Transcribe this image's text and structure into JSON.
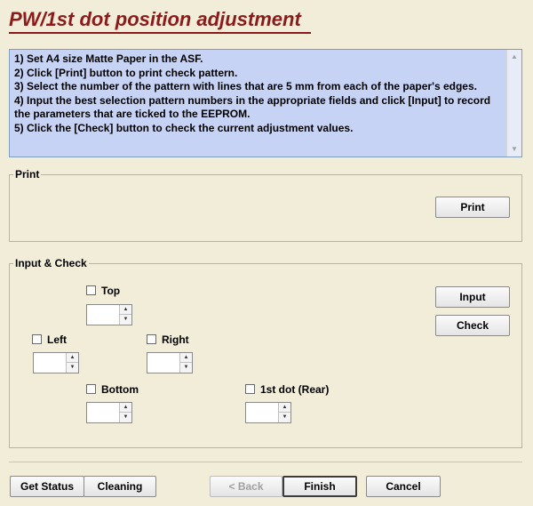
{
  "title": "PW/1st dot position adjustment",
  "instructions": {
    "text": "1) Set A4 size Matte Paper in the ASF.\n2) Click [Print] button to print check pattern.\n3) Select the number of the pattern with lines that are 5 mm from each of the paper's edges.\n4) Input the best selection pattern numbers in the appropriate fields and click [Input] to record the parameters that are ticked to the EEPROM.\n5) Click the [Check] button to check the current adjustment values."
  },
  "print_group": {
    "label": "Print",
    "print_button": "Print"
  },
  "input_group": {
    "label": "Input & Check",
    "input_button": "Input",
    "check_button": "Check",
    "top_label": "Top",
    "left_label": "Left",
    "right_label": "Right",
    "bottom_label": "Bottom",
    "first_dot_label": "1st dot (Rear)",
    "top_value": "",
    "left_value": "",
    "right_value": "",
    "bottom_value": "",
    "first_dot_value": ""
  },
  "footer": {
    "get_status": "Get Status",
    "cleaning": "Cleaning",
    "back": "< Back",
    "finish": "Finish",
    "cancel": "Cancel"
  },
  "icons": {
    "scroll_up": "chevron-up-icon",
    "scroll_down": "chevron-down-icon",
    "spin_up": "spin-up-icon",
    "spin_down": "spin-down-icon"
  },
  "colors": {
    "background": "#f2edd8",
    "title": "#8b1a1a",
    "instructions_bg": "#c7d3f5"
  }
}
